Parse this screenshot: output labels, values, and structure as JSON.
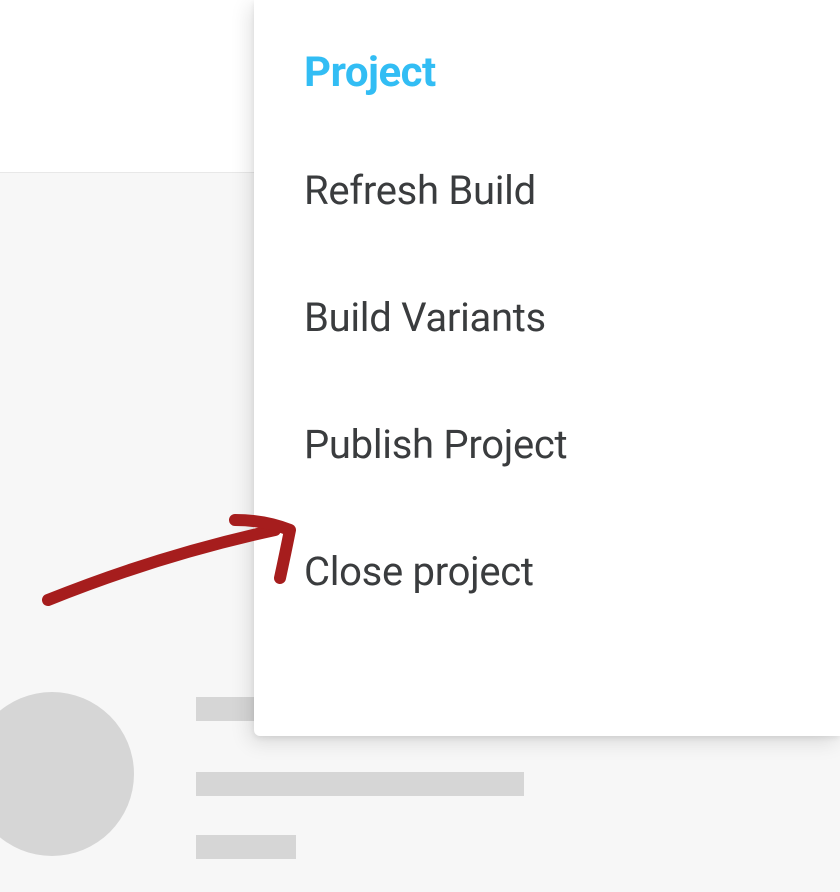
{
  "menu": {
    "title": "Project",
    "items": [
      {
        "label": "Refresh Build"
      },
      {
        "label": "Build Variants"
      },
      {
        "label": "Publish Project"
      },
      {
        "label": "Close project"
      }
    ]
  },
  "colors": {
    "accent": "#32bdf4",
    "text": "#3a3c3e",
    "placeholder": "#d6d6d6",
    "annotation": "#a61d1d"
  }
}
